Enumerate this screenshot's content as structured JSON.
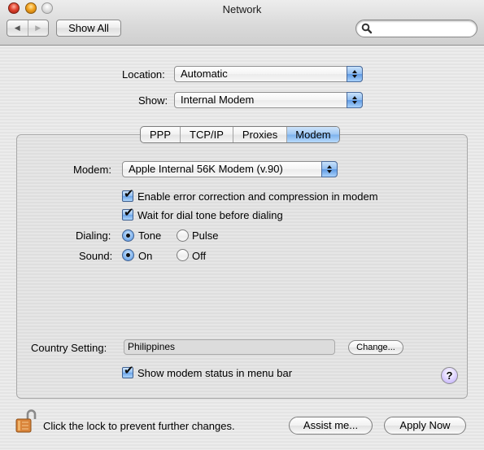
{
  "window": {
    "title": "Network"
  },
  "toolbar": {
    "back_icon": "◀",
    "forward_icon": "▶",
    "show_all_label": "Show All",
    "search_value": "",
    "search_placeholder": ""
  },
  "location": {
    "label": "Location:",
    "value": "Automatic"
  },
  "show": {
    "label": "Show:",
    "value": "Internal Modem"
  },
  "tabs": [
    {
      "label": "PPP",
      "active": false
    },
    {
      "label": "TCP/IP",
      "active": false
    },
    {
      "label": "Proxies",
      "active": false
    },
    {
      "label": "Modem",
      "active": true
    }
  ],
  "modem": {
    "label": "Modem:",
    "value": "Apple Internal 56K Modem (v.90)",
    "error_correction": {
      "label": "Enable error correction and compression in modem",
      "checked": true
    },
    "wait_dial_tone": {
      "label": "Wait for dial tone before dialing",
      "checked": true
    },
    "dialing": {
      "label": "Dialing:",
      "options": [
        {
          "label": "Tone",
          "selected": true
        },
        {
          "label": "Pulse",
          "selected": false
        }
      ]
    },
    "sound": {
      "label": "Sound:",
      "options": [
        {
          "label": "On",
          "selected": true
        },
        {
          "label": "Off",
          "selected": false
        }
      ]
    },
    "country": {
      "label": "Country Setting:",
      "value": "Philippines",
      "change_label": "Change..."
    },
    "show_status": {
      "label": "Show modem status in menu bar",
      "checked": true
    },
    "help_label": "?"
  },
  "footer": {
    "lock_text": "Click the lock to prevent further changes.",
    "assist_label": "Assist me...",
    "apply_label": "Apply Now"
  },
  "icons": {
    "check": "✔"
  }
}
